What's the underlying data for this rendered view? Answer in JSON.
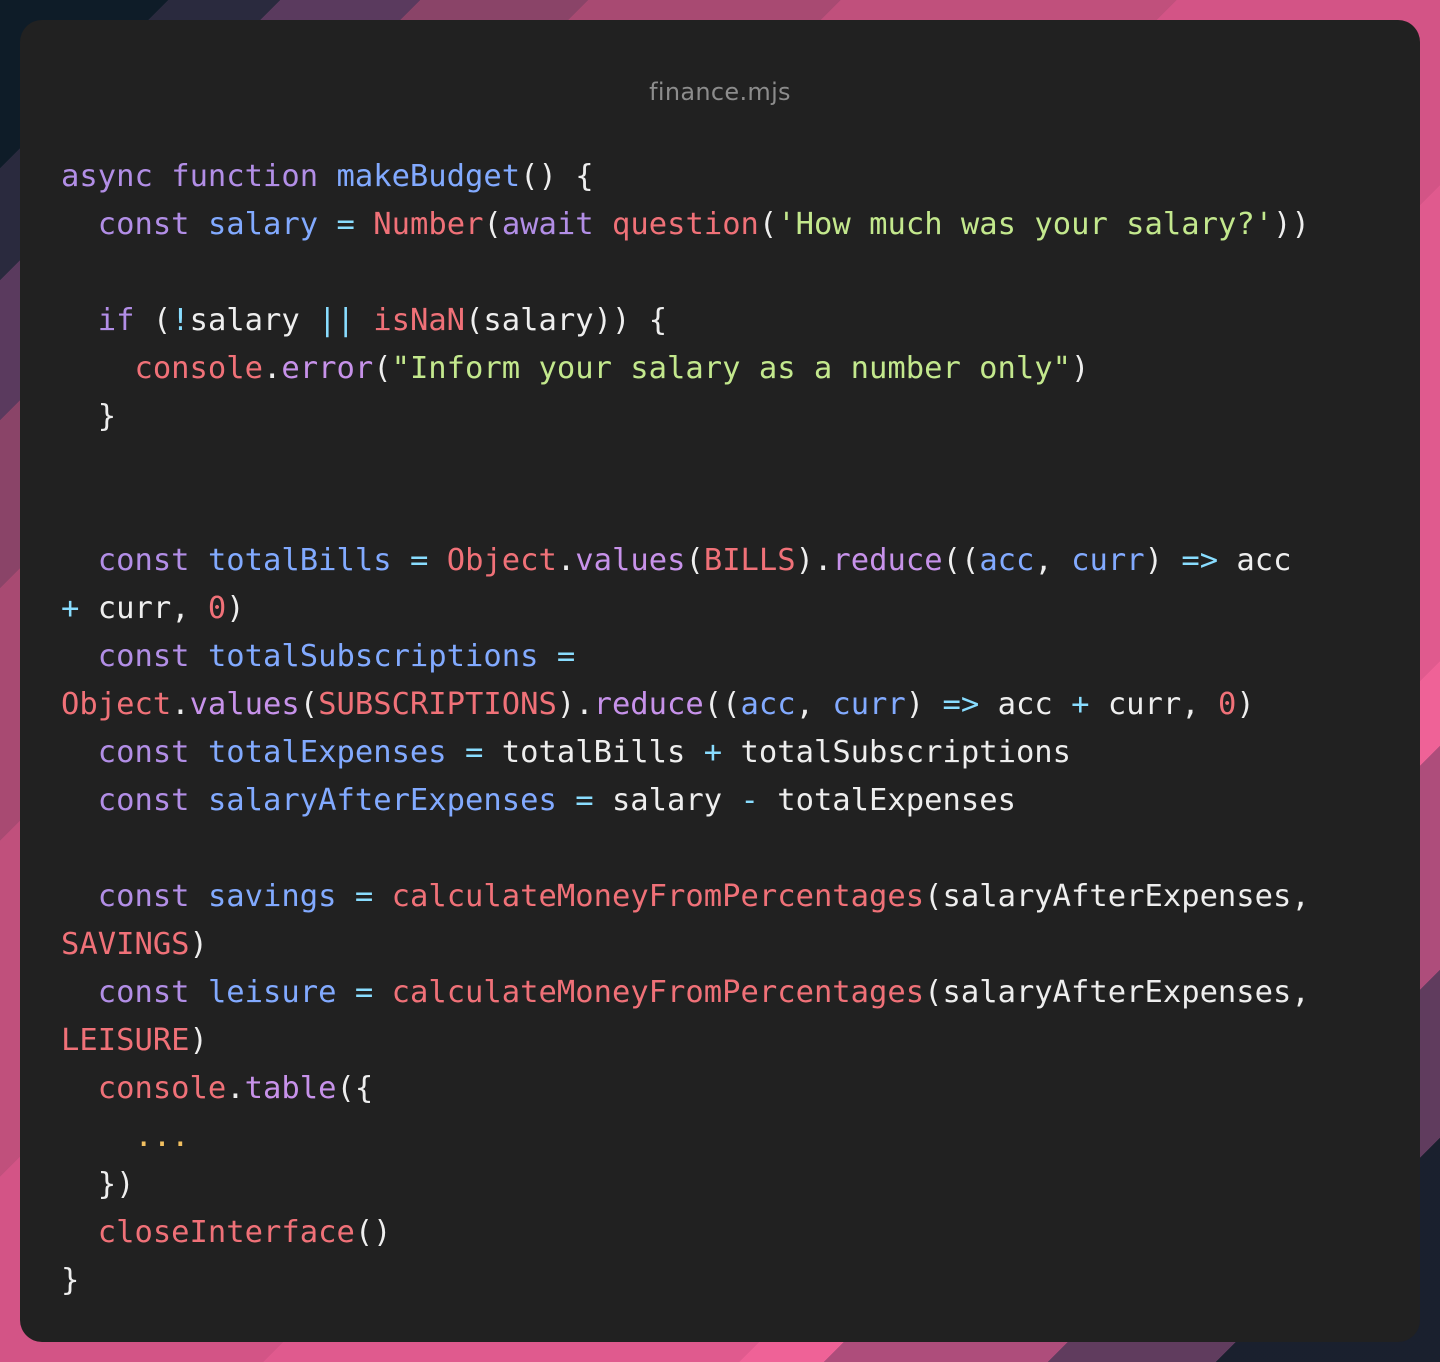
{
  "window": {
    "title": "finance.mjs"
  },
  "colors": {
    "window_bg": "#212121",
    "keyword": "#b28ee6",
    "function_name": "#82aaff",
    "call": "#f07178",
    "string": "#c3e88d",
    "operator": "#89ddff",
    "plain": "#eeeeee",
    "ellipsis": "#f2c060"
  },
  "code_lines": [
    [
      {
        "t": "async",
        "c": "kw"
      },
      {
        "t": " ",
        "c": "plain"
      },
      {
        "t": "function",
        "c": "kw"
      },
      {
        "t": " ",
        "c": "plain"
      },
      {
        "t": "makeBudget",
        "c": "fn"
      },
      {
        "t": "() {",
        "c": "punc"
      }
    ],
    [
      {
        "t": "  ",
        "c": "plain"
      },
      {
        "t": "const",
        "c": "kw"
      },
      {
        "t": " ",
        "c": "plain"
      },
      {
        "t": "salary",
        "c": "var"
      },
      {
        "t": " ",
        "c": "plain"
      },
      {
        "t": "=",
        "c": "op"
      },
      {
        "t": " ",
        "c": "plain"
      },
      {
        "t": "Number",
        "c": "call"
      },
      {
        "t": "(",
        "c": "punc"
      },
      {
        "t": "await",
        "c": "kw"
      },
      {
        "t": " ",
        "c": "plain"
      },
      {
        "t": "question",
        "c": "call"
      },
      {
        "t": "(",
        "c": "punc"
      },
      {
        "t": "'How much was your salary?'",
        "c": "str"
      },
      {
        "t": "))",
        "c": "punc"
      }
    ],
    [],
    [
      {
        "t": "  ",
        "c": "plain"
      },
      {
        "t": "if",
        "c": "kw"
      },
      {
        "t": " (",
        "c": "punc"
      },
      {
        "t": "!",
        "c": "op"
      },
      {
        "t": "salary ",
        "c": "plain"
      },
      {
        "t": "||",
        "c": "op"
      },
      {
        "t": " ",
        "c": "plain"
      },
      {
        "t": "isNaN",
        "c": "call"
      },
      {
        "t": "(salary)) {",
        "c": "punc"
      }
    ],
    [
      {
        "t": "    ",
        "c": "plain"
      },
      {
        "t": "console",
        "c": "call"
      },
      {
        "t": ".",
        "c": "punc"
      },
      {
        "t": "error",
        "c": "method"
      },
      {
        "t": "(",
        "c": "punc"
      },
      {
        "t": "\"Inform your salary as a number only\"",
        "c": "str"
      },
      {
        "t": ")",
        "c": "punc"
      }
    ],
    [
      {
        "t": "  }",
        "c": "punc"
      }
    ],
    [],
    [],
    [
      {
        "t": "  ",
        "c": "plain"
      },
      {
        "t": "const",
        "c": "kw"
      },
      {
        "t": " ",
        "c": "plain"
      },
      {
        "t": "totalBills",
        "c": "var"
      },
      {
        "t": " ",
        "c": "plain"
      },
      {
        "t": "=",
        "c": "op"
      },
      {
        "t": " ",
        "c": "plain"
      },
      {
        "t": "Object",
        "c": "call"
      },
      {
        "t": ".",
        "c": "punc"
      },
      {
        "t": "values",
        "c": "method"
      },
      {
        "t": "(",
        "c": "punc"
      },
      {
        "t": "BILLS",
        "c": "const"
      },
      {
        "t": ").",
        "c": "punc"
      },
      {
        "t": "reduce",
        "c": "method"
      },
      {
        "t": "((",
        "c": "punc"
      },
      {
        "t": "acc",
        "c": "var"
      },
      {
        "t": ", ",
        "c": "punc"
      },
      {
        "t": "curr",
        "c": "var"
      },
      {
        "t": ") ",
        "c": "punc"
      },
      {
        "t": "=>",
        "c": "op"
      },
      {
        "t": " acc",
        "c": "plain"
      }
    ],
    [
      {
        "t": "+",
        "c": "op"
      },
      {
        "t": " curr, ",
        "c": "plain"
      },
      {
        "t": "0",
        "c": "num"
      },
      {
        "t": ")",
        "c": "punc"
      }
    ],
    [
      {
        "t": "  ",
        "c": "plain"
      },
      {
        "t": "const",
        "c": "kw"
      },
      {
        "t": " ",
        "c": "plain"
      },
      {
        "t": "totalSubscriptions",
        "c": "var"
      },
      {
        "t": " ",
        "c": "plain"
      },
      {
        "t": "=",
        "c": "op"
      }
    ],
    [
      {
        "t": "Object",
        "c": "call"
      },
      {
        "t": ".",
        "c": "punc"
      },
      {
        "t": "values",
        "c": "method"
      },
      {
        "t": "(",
        "c": "punc"
      },
      {
        "t": "SUBSCRIPTIONS",
        "c": "const"
      },
      {
        "t": ").",
        "c": "punc"
      },
      {
        "t": "reduce",
        "c": "method"
      },
      {
        "t": "((",
        "c": "punc"
      },
      {
        "t": "acc",
        "c": "var"
      },
      {
        "t": ", ",
        "c": "punc"
      },
      {
        "t": "curr",
        "c": "var"
      },
      {
        "t": ") ",
        "c": "punc"
      },
      {
        "t": "=>",
        "c": "op"
      },
      {
        "t": " acc ",
        "c": "plain"
      },
      {
        "t": "+",
        "c": "op"
      },
      {
        "t": " curr, ",
        "c": "plain"
      },
      {
        "t": "0",
        "c": "num"
      },
      {
        "t": ")",
        "c": "punc"
      }
    ],
    [
      {
        "t": "  ",
        "c": "plain"
      },
      {
        "t": "const",
        "c": "kw"
      },
      {
        "t": " ",
        "c": "plain"
      },
      {
        "t": "totalExpenses",
        "c": "var"
      },
      {
        "t": " ",
        "c": "plain"
      },
      {
        "t": "=",
        "c": "op"
      },
      {
        "t": " totalBills ",
        "c": "plain"
      },
      {
        "t": "+",
        "c": "op"
      },
      {
        "t": " totalSubscriptions",
        "c": "plain"
      }
    ],
    [
      {
        "t": "  ",
        "c": "plain"
      },
      {
        "t": "const",
        "c": "kw"
      },
      {
        "t": " ",
        "c": "plain"
      },
      {
        "t": "salaryAfterExpenses",
        "c": "var"
      },
      {
        "t": " ",
        "c": "plain"
      },
      {
        "t": "=",
        "c": "op"
      },
      {
        "t": " salary ",
        "c": "plain"
      },
      {
        "t": "-",
        "c": "op"
      },
      {
        "t": " totalExpenses",
        "c": "plain"
      }
    ],
    [],
    [
      {
        "t": "  ",
        "c": "plain"
      },
      {
        "t": "const",
        "c": "kw"
      },
      {
        "t": " ",
        "c": "plain"
      },
      {
        "t": "savings",
        "c": "var"
      },
      {
        "t": " ",
        "c": "plain"
      },
      {
        "t": "=",
        "c": "op"
      },
      {
        "t": " ",
        "c": "plain"
      },
      {
        "t": "calculateMoneyFromPercentages",
        "c": "call"
      },
      {
        "t": "(salaryAfterExpenses,",
        "c": "punc"
      }
    ],
    [
      {
        "t": "SAVINGS",
        "c": "const"
      },
      {
        "t": ")",
        "c": "punc"
      }
    ],
    [
      {
        "t": "  ",
        "c": "plain"
      },
      {
        "t": "const",
        "c": "kw"
      },
      {
        "t": " ",
        "c": "plain"
      },
      {
        "t": "leisure",
        "c": "var"
      },
      {
        "t": " ",
        "c": "plain"
      },
      {
        "t": "=",
        "c": "op"
      },
      {
        "t": " ",
        "c": "plain"
      },
      {
        "t": "calculateMoneyFromPercentages",
        "c": "call"
      },
      {
        "t": "(salaryAfterExpenses,",
        "c": "punc"
      }
    ],
    [
      {
        "t": "LEISURE",
        "c": "const"
      },
      {
        "t": ")",
        "c": "punc"
      }
    ],
    [
      {
        "t": "  ",
        "c": "plain"
      },
      {
        "t": "console",
        "c": "call"
      },
      {
        "t": ".",
        "c": "punc"
      },
      {
        "t": "table",
        "c": "method"
      },
      {
        "t": "({",
        "c": "punc"
      }
    ],
    [
      {
        "t": "    ",
        "c": "plain"
      },
      {
        "t": "...",
        "c": "ellipsis"
      }
    ],
    [
      {
        "t": "  })",
        "c": "punc"
      }
    ],
    [
      {
        "t": "  ",
        "c": "plain"
      },
      {
        "t": "closeInterface",
        "c": "call"
      },
      {
        "t": "()",
        "c": "punc"
      }
    ],
    [
      {
        "t": "}",
        "c": "punc"
      }
    ]
  ]
}
